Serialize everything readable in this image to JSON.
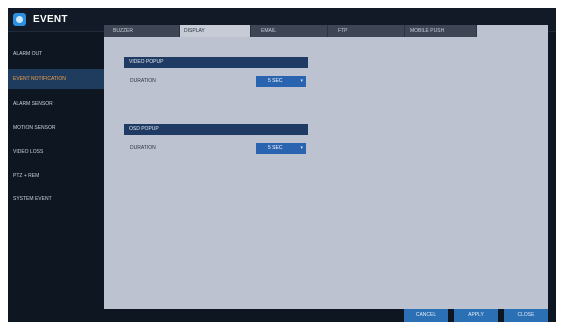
{
  "window": {
    "title": "EVENT"
  },
  "sidebar": {
    "items": [
      {
        "label": "ALARM OUT"
      },
      {
        "label": "EVENT NOTIFICATION"
      },
      {
        "label": "ALARM SENSOR"
      },
      {
        "label": "MOTION SENSOR"
      },
      {
        "label": "VIDEO LOSS"
      },
      {
        "label": "PTZ + REM"
      },
      {
        "label": "SYSTEM EVENT"
      }
    ]
  },
  "tabs": [
    {
      "label": "BUZZER"
    },
    {
      "label": "DISPLAY"
    },
    {
      "label": "EMAIL"
    },
    {
      "label": "FTP"
    },
    {
      "label": "MOBILE PUSH"
    }
  ],
  "sections": {
    "video_popup": {
      "header": "VIDEO POPUP",
      "field_label": "DURATION",
      "value": "5 SEC"
    },
    "osd_popup": {
      "header": "OSD POPUP",
      "field_label": "DURATION",
      "value": "5 SEC"
    }
  },
  "buttons": {
    "cancel": "CANCEL",
    "apply": "APPLY",
    "close": "CLOSE"
  }
}
